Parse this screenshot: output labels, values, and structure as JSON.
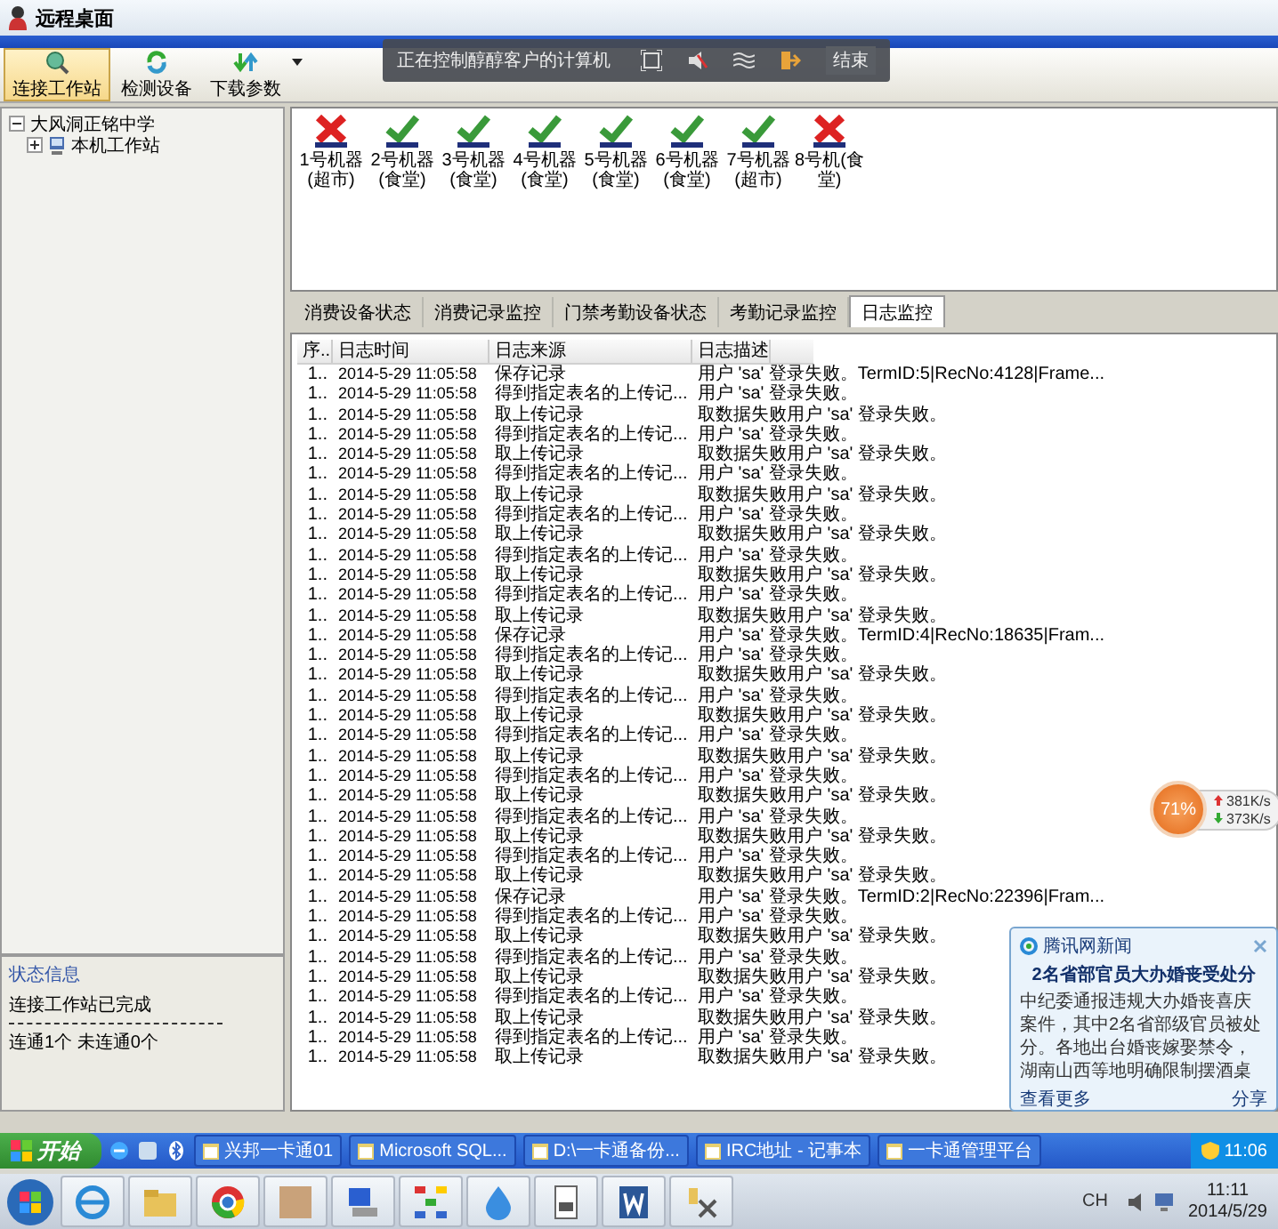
{
  "window": {
    "title": "远程桌面"
  },
  "remote_control_bar": {
    "message": "正在控制醇醇客户的计算机",
    "end_button": "结束"
  },
  "toolbar": [
    {
      "label": "连接工作站",
      "kind": "connect",
      "selected": true
    },
    {
      "label": "检测设备",
      "kind": "detect",
      "selected": false
    },
    {
      "label": "下载参数",
      "kind": "download",
      "selected": false
    }
  ],
  "tree": [
    {
      "label": "大风洞正铭中学",
      "expanded": true,
      "children": [
        {
          "label": "本机工作站",
          "expanded": false
        }
      ]
    }
  ],
  "status_panel": {
    "title": "状态信息",
    "lines": [
      "连接工作站已完成",
      "连通1个 未连通0个"
    ]
  },
  "machines": [
    {
      "label": "1号机器(超市)",
      "online": false
    },
    {
      "label": "2号机器(食堂)",
      "online": true
    },
    {
      "label": "3号机器(食堂)",
      "online": true
    },
    {
      "label": "4号机器(食堂)",
      "online": true
    },
    {
      "label": "5号机器(食堂)",
      "online": true
    },
    {
      "label": "6号机器(食堂)",
      "online": true
    },
    {
      "label": "7号机器(超市)",
      "online": true
    },
    {
      "label": "8号机(食堂)",
      "online": false
    }
  ],
  "tabs": [
    {
      "label": "消费设备状态",
      "selected": false
    },
    {
      "label": "消费记录监控",
      "selected": false
    },
    {
      "label": "门禁考勤设备状态",
      "selected": false
    },
    {
      "label": "考勤记录监控",
      "selected": false
    },
    {
      "label": "日志监控",
      "selected": true
    }
  ],
  "log_table": {
    "columns": [
      "序..",
      "日志时间",
      "日志来源",
      "日志描述"
    ],
    "rows": [
      [
        "1..",
        "2014-5-29 11:05:58",
        "保存记录",
        "用户 'sa' 登录失败。TermID:5|RecNo:4128|Frame..."
      ],
      [
        "1..",
        "2014-5-29 11:05:58",
        "得到指定表名的上传记...",
        "用户 'sa' 登录失败。"
      ],
      [
        "1..",
        "2014-5-29 11:05:58",
        "取上传记录",
        "取数据失败用户 'sa' 登录失败。"
      ],
      [
        "1..",
        "2014-5-29 11:05:58",
        "得到指定表名的上传记...",
        "用户 'sa' 登录失败。"
      ],
      [
        "1..",
        "2014-5-29 11:05:58",
        "取上传记录",
        "取数据失败用户 'sa' 登录失败。"
      ],
      [
        "1..",
        "2014-5-29 11:05:58",
        "得到指定表名的上传记...",
        "用户 'sa' 登录失败。"
      ],
      [
        "1..",
        "2014-5-29 11:05:58",
        "取上传记录",
        "取数据失败用户 'sa' 登录失败。"
      ],
      [
        "1..",
        "2014-5-29 11:05:58",
        "得到指定表名的上传记...",
        "用户 'sa' 登录失败。"
      ],
      [
        "1..",
        "2014-5-29 11:05:58",
        "取上传记录",
        "取数据失败用户 'sa' 登录失败。"
      ],
      [
        "1..",
        "2014-5-29 11:05:58",
        "得到指定表名的上传记...",
        "用户 'sa' 登录失败。"
      ],
      [
        "1..",
        "2014-5-29 11:05:58",
        "取上传记录",
        "取数据失败用户 'sa' 登录失败。"
      ],
      [
        "1..",
        "2014-5-29 11:05:58",
        "得到指定表名的上传记...",
        "用户 'sa' 登录失败。"
      ],
      [
        "1..",
        "2014-5-29 11:05:58",
        "取上传记录",
        "取数据失败用户 'sa' 登录失败。"
      ],
      [
        "1..",
        "2014-5-29 11:05:58",
        "保存记录",
        "用户 'sa' 登录失败。TermID:4|RecNo:18635|Fram..."
      ],
      [
        "1..",
        "2014-5-29 11:05:58",
        "得到指定表名的上传记...",
        "用户 'sa' 登录失败。"
      ],
      [
        "1..",
        "2014-5-29 11:05:58",
        "取上传记录",
        "取数据失败用户 'sa' 登录失败。"
      ],
      [
        "1..",
        "2014-5-29 11:05:58",
        "得到指定表名的上传记...",
        "用户 'sa' 登录失败。"
      ],
      [
        "1..",
        "2014-5-29 11:05:58",
        "取上传记录",
        "取数据失败用户 'sa' 登录失败。"
      ],
      [
        "1..",
        "2014-5-29 11:05:58",
        "得到指定表名的上传记...",
        "用户 'sa' 登录失败。"
      ],
      [
        "1..",
        "2014-5-29 11:05:58",
        "取上传记录",
        "取数据失败用户 'sa' 登录失败。"
      ],
      [
        "1..",
        "2014-5-29 11:05:58",
        "得到指定表名的上传记...",
        "用户 'sa' 登录失败。"
      ],
      [
        "1..",
        "2014-5-29 11:05:58",
        "取上传记录",
        "取数据失败用户 'sa' 登录失败。"
      ],
      [
        "1..",
        "2014-5-29 11:05:58",
        "得到指定表名的上传记...",
        "用户 'sa' 登录失败。"
      ],
      [
        "1..",
        "2014-5-29 11:05:58",
        "取上传记录",
        "取数据失败用户 'sa' 登录失败。"
      ],
      [
        "1..",
        "2014-5-29 11:05:58",
        "得到指定表名的上传记...",
        "用户 'sa' 登录失败。"
      ],
      [
        "1..",
        "2014-5-29 11:05:58",
        "取上传记录",
        "取数据失败用户 'sa' 登录失败。"
      ],
      [
        "1..",
        "2014-5-29 11:05:58",
        "保存记录",
        "用户 'sa' 登录失败。TermID:2|RecNo:22396|Fram..."
      ],
      [
        "1..",
        "2014-5-29 11:05:58",
        "得到指定表名的上传记...",
        "用户 'sa' 登录失败。"
      ],
      [
        "1..",
        "2014-5-29 11:05:58",
        "取上传记录",
        "取数据失败用户 'sa' 登录失败。"
      ],
      [
        "1..",
        "2014-5-29 11:05:58",
        "得到指定表名的上传记...",
        "用户 'sa' 登录失败。"
      ],
      [
        "1..",
        "2014-5-29 11:05:58",
        "取上传记录",
        "取数据失败用户 'sa' 登录失败。"
      ],
      [
        "1..",
        "2014-5-29 11:05:58",
        "得到指定表名的上传记...",
        "用户 'sa' 登录失败。"
      ],
      [
        "1..",
        "2014-5-29 11:05:58",
        "取上传记录",
        "取数据失败用户 'sa' 登录失败。"
      ],
      [
        "1..",
        "2014-5-29 11:05:58",
        "得到指定表名的上传记...",
        "用户 'sa' 登录失败。"
      ],
      [
        "1..",
        "2014-5-29 11:05:58",
        "取上传记录",
        "取数据失败用户 'sa' 登录失败。"
      ]
    ]
  },
  "net_meter": {
    "percent": "71%",
    "upload": "381K/s",
    "download": "373K/s"
  },
  "news_popup": {
    "source": "腾讯网新闻",
    "headline": "2名省部官员大办婚丧受处分",
    "body": "中纪委通报违规大办婚丧喜庆案件，其中2名省部级官员被处分。各地出台婚丧嫁娶禁令，湖南山西等地明确限制摆酒桌",
    "more_link": "查看更多",
    "share_link": "分享"
  },
  "xp_taskbar": {
    "start": "开始",
    "tasks": [
      "兴邦一卡通01",
      "Microsoft SQL...",
      "D:\\一卡通备份...",
      "IRC地址 - 记事本",
      "一卡通管理平台"
    ],
    "time": "11:06"
  },
  "win7_taskbar": {
    "language": "CH",
    "time": "11:11",
    "date": "2014/5/29"
  }
}
